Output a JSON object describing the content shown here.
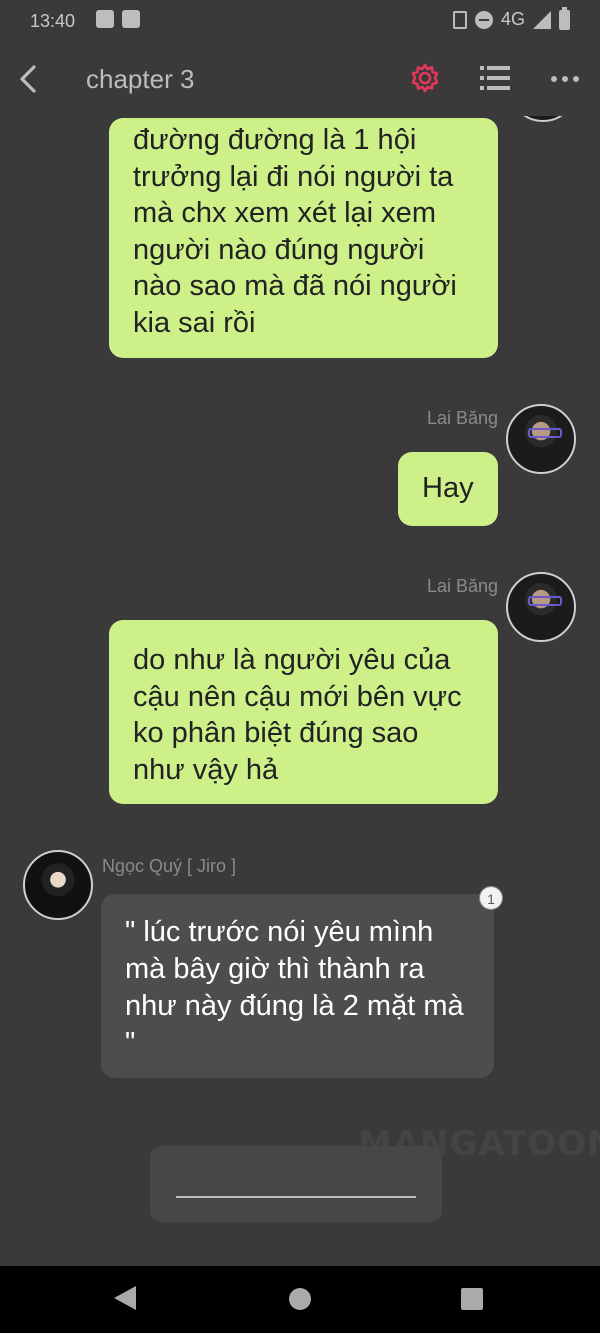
{
  "status_bar": {
    "time": "13:40",
    "network": "4G"
  },
  "toolbar": {
    "title": "chapter 3",
    "accent_color": "#e8365a"
  },
  "messages": [
    {
      "side": "right",
      "sender": "",
      "text": "đường đường là 1 hội trưởng lại đi nói người ta mà chx xem xét lại xem người nào đúng người nào sao mà đã nói người kia sai rồi"
    },
    {
      "side": "right",
      "sender": "Lai Băng",
      "text": "Hay"
    },
    {
      "side": "right",
      "sender": "Lai Băng",
      "text": "do như là người yêu của cậu nên cậu mới bên vực ko phân biệt đúng sao như vậy hả"
    },
    {
      "side": "left",
      "sender": "Ngọc Quý [ Jiro ]",
      "text": "\" lúc trước nói yêu mình mà bây giờ thì thành ra như này đúng là 2 mặt mà \"",
      "badge": "1"
    }
  ],
  "watermark": "MANGATOON",
  "colors": {
    "background": "#3a3a3a",
    "green_bubble": "#cdf089",
    "dark_bubble": "#4d4d4d"
  }
}
